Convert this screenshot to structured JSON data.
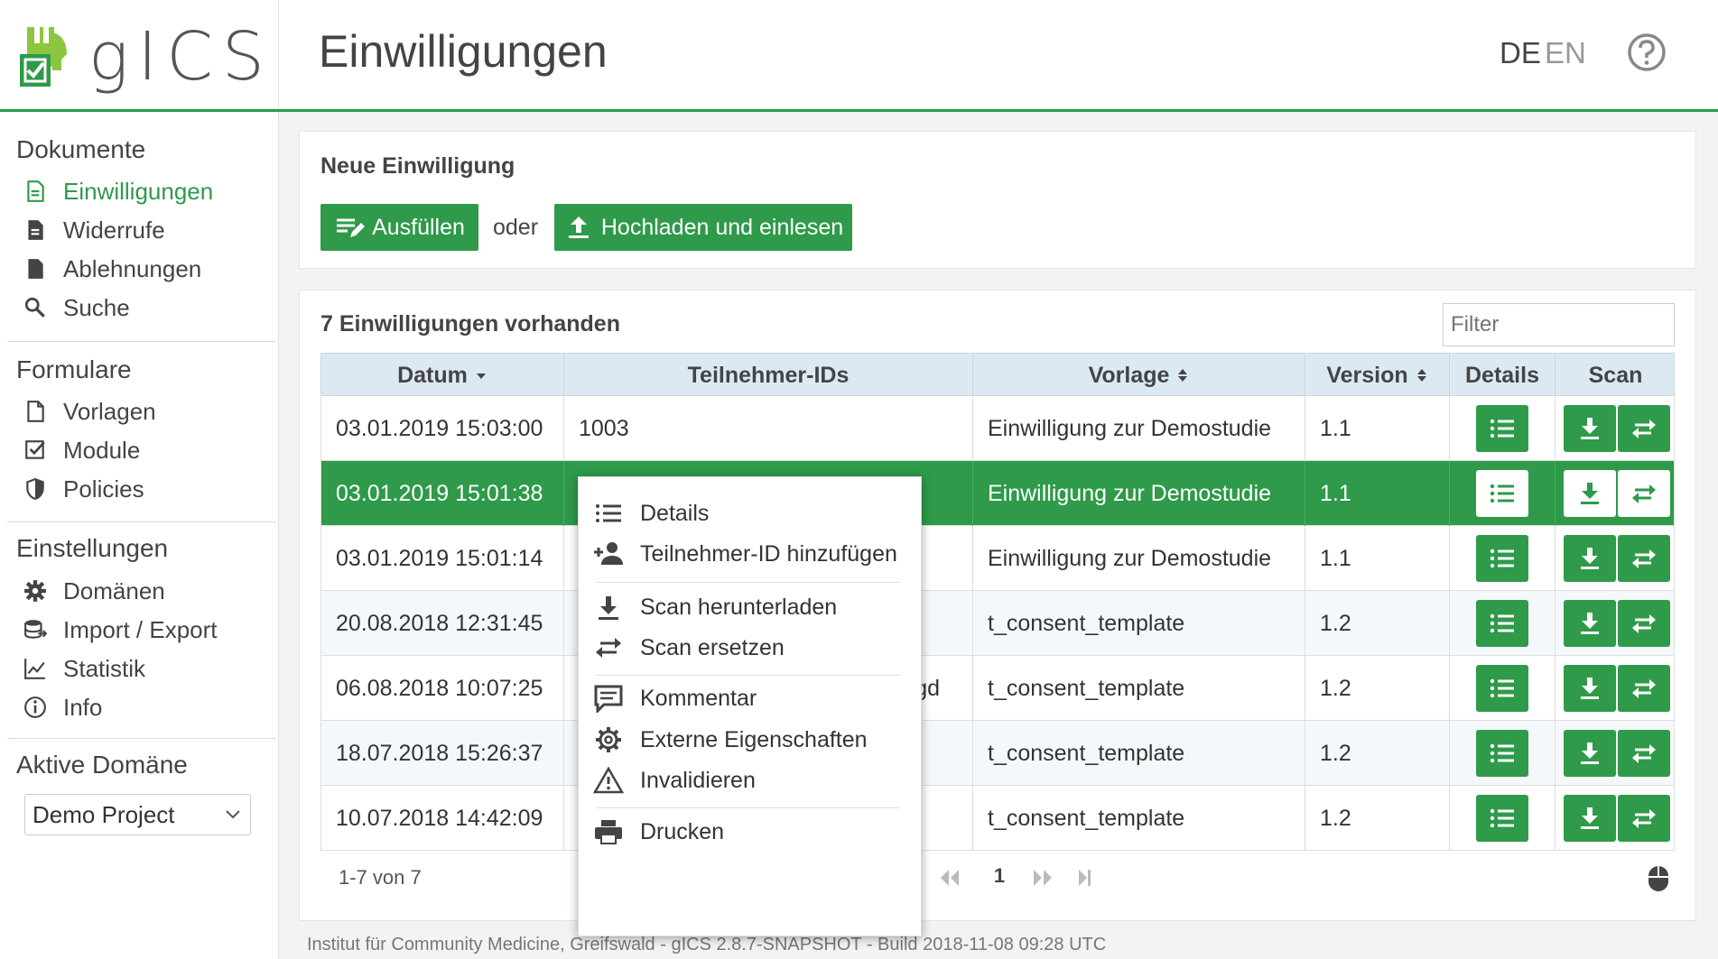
{
  "header": {
    "logo_text": "gICS",
    "page_title": "Einwilligungen",
    "lang_de": "DE",
    "lang_en": "EN"
  },
  "sidebar": {
    "section_documents": "Dokumente",
    "documents": [
      {
        "label": "Einwilligungen",
        "icon": "document-lines-icon",
        "active": true
      },
      {
        "label": "Widerrufe",
        "icon": "document-filled-icon"
      },
      {
        "label": "Ablehnungen",
        "icon": "document-blank-icon"
      },
      {
        "label": "Suche",
        "icon": "search-icon"
      }
    ],
    "section_forms": "Formulare",
    "forms": [
      {
        "label": "Vorlagen",
        "icon": "document-outline-icon"
      },
      {
        "label": "Module",
        "icon": "checkbox-icon"
      },
      {
        "label": "Policies",
        "icon": "shield-icon"
      }
    ],
    "section_settings": "Einstellungen",
    "settings": [
      {
        "label": "Domänen",
        "icon": "gear-icon"
      },
      {
        "label": "Import / Export",
        "icon": "database-icon"
      },
      {
        "label": "Statistik",
        "icon": "line-chart-icon"
      },
      {
        "label": "Info",
        "icon": "info-icon"
      }
    ],
    "section_domain": "Aktive Domäne",
    "domain_selected": "Demo Project"
  },
  "new_consent": {
    "title": "Neue Einwilligung",
    "fill_label": "Ausfüllen",
    "or_label": "oder",
    "upload_label": "Hochladen und einlesen"
  },
  "list": {
    "title": "7 Einwilligungen vorhanden",
    "filter_placeholder": "Filter",
    "columns": {
      "date": "Datum",
      "participants": "Teilnehmer-IDs",
      "template": "Vorlage",
      "version": "Version",
      "details": "Details",
      "scan": "Scan"
    },
    "rows": [
      {
        "date": "03.01.2019 15:03:00",
        "participants": "1003",
        "template": "Einwilligung zur Demostudie",
        "version": "1.1"
      },
      {
        "date": "03.01.2019 15:01:38",
        "participants": "",
        "template": "Einwilligung zur Demostudie",
        "version": "1.1"
      },
      {
        "date": "03.01.2019 15:01:14",
        "participants": "",
        "template": "Einwilligung zur Demostudie",
        "version": "1.1"
      },
      {
        "date": "20.08.2018 12:31:45",
        "participants": "",
        "template": "t_consent_template",
        "version": "1.2"
      },
      {
        "date": "06.08.2018 10:07:25",
        "participants": "gd",
        "template": "t_consent_template",
        "version": "1.2"
      },
      {
        "date": "18.07.2018 15:26:37",
        "participants": "",
        "template": "t_consent_template",
        "version": "1.2"
      },
      {
        "date": "10.07.2018 14:42:09",
        "participants": "",
        "template": "t_consent_template",
        "version": "1.2"
      }
    ],
    "pager_info": "1-7 von 7",
    "current_page": "1"
  },
  "context_menu": {
    "details": "Details",
    "add_participant": "Teilnehmer-ID hinzufügen",
    "download_scan": "Scan herunterladen",
    "replace_scan": "Scan ersetzen",
    "comment": "Kommentar",
    "external_properties": "Externe Eigenschaften",
    "invalidate": "Invalidieren",
    "print": "Drucken"
  },
  "footer": "Institut für Community Medicine, Greifswald - gICS 2.8.7-SNAPSHOT - Build 2018-11-08 09:28 UTC",
  "colors": {
    "primary": "#2e9a4a",
    "table_header": "#dce9f3"
  }
}
